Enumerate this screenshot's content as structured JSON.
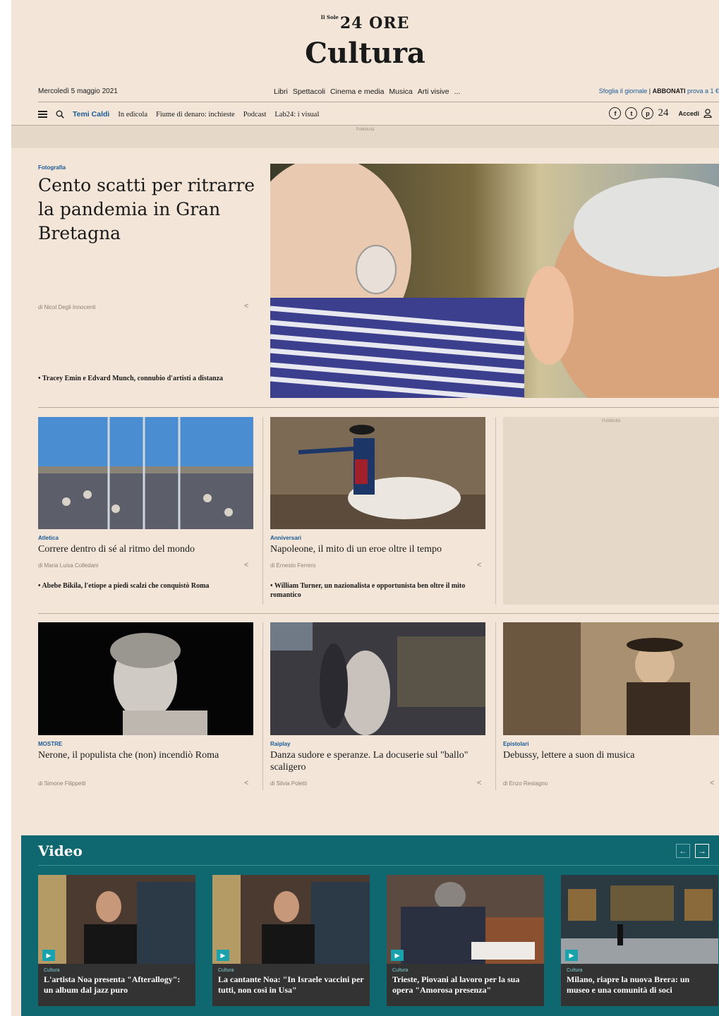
{
  "masthead": {
    "brand_prefix": "Il Sole",
    "brand": "24 ORE",
    "section": "Cultura"
  },
  "date": "Mercoledì 5 maggio 2021",
  "top_nav": [
    "Libri",
    "Spettacoli",
    "Cinema e media",
    "Musica",
    "Arti visive",
    "..."
  ],
  "top_right": {
    "browse": "Sfoglia il giornale",
    "separator": "|",
    "subscribe": "ABBONATI",
    "offer": "prova a 1 €"
  },
  "sub_nav": {
    "hot": "Temi Caldi",
    "items": [
      "In edicola",
      "Fiume di denaro: inchieste",
      "Podcast",
      "Lab24: i visual"
    ],
    "count": "24",
    "login": "Accedi"
  },
  "ad_label": "Pubblicità",
  "hero": {
    "tag": "Fotografia",
    "title": "Cento scatti per ritrarre la pandemia in Gran Bretagna",
    "author": "di Nicol Degli Innocenti",
    "related": "Tracey Emin e Edvard Munch, connubio d'artisti a distanza"
  },
  "cards_row1": [
    {
      "tag": "Atletica",
      "title": "Correre dentro di sé al ritmo del mondo",
      "author": "di Maria Luisa Colledani",
      "related": "Abebe Bikila, l'etiope a piedi scalzi che conquistò Roma"
    },
    {
      "tag": "Anniversari",
      "title": "Napoleone, il mito di un eroe oltre il tempo",
      "author": "di Ernesto Ferrero",
      "related": "William Turner, un nazionalista e opportunista ben oltre il mito romantico"
    }
  ],
  "cards_row2": [
    {
      "tag": "MOSTRE",
      "title": "Nerone, il populista che (non) incendiò Roma",
      "author": "di Simone Filippetti"
    },
    {
      "tag": "Raiplay",
      "title": "Danza sudore e speranze. La docuserie sul \"ballo\" scaligero",
      "author": "di Silvia Poletti"
    },
    {
      "tag": "Epistolari",
      "title": "Debussy, lettere a suon di musica",
      "author": "di Enzo Restagno"
    }
  ],
  "video": {
    "heading": "Video",
    "items": [
      {
        "tag": "Cultura",
        "title": "L'artista Noa presenta \"Afterallogy\": un album dal jazz puro"
      },
      {
        "tag": "Cultura",
        "title": "La cantante Noa: \"In Israele vaccini per tutti, non così in Usa\""
      },
      {
        "tag": "Cultura",
        "title": "Trieste, Piovani al lavoro per la sua opera \"Amorosa presenza\""
      },
      {
        "tag": "Cultura",
        "title": "Milano, riapre la nuova Brera: un museo e una comunità di soci"
      }
    ]
  },
  "icons": {
    "facebook": "f",
    "twitter": "t",
    "podcast": "p",
    "share": "<"
  }
}
